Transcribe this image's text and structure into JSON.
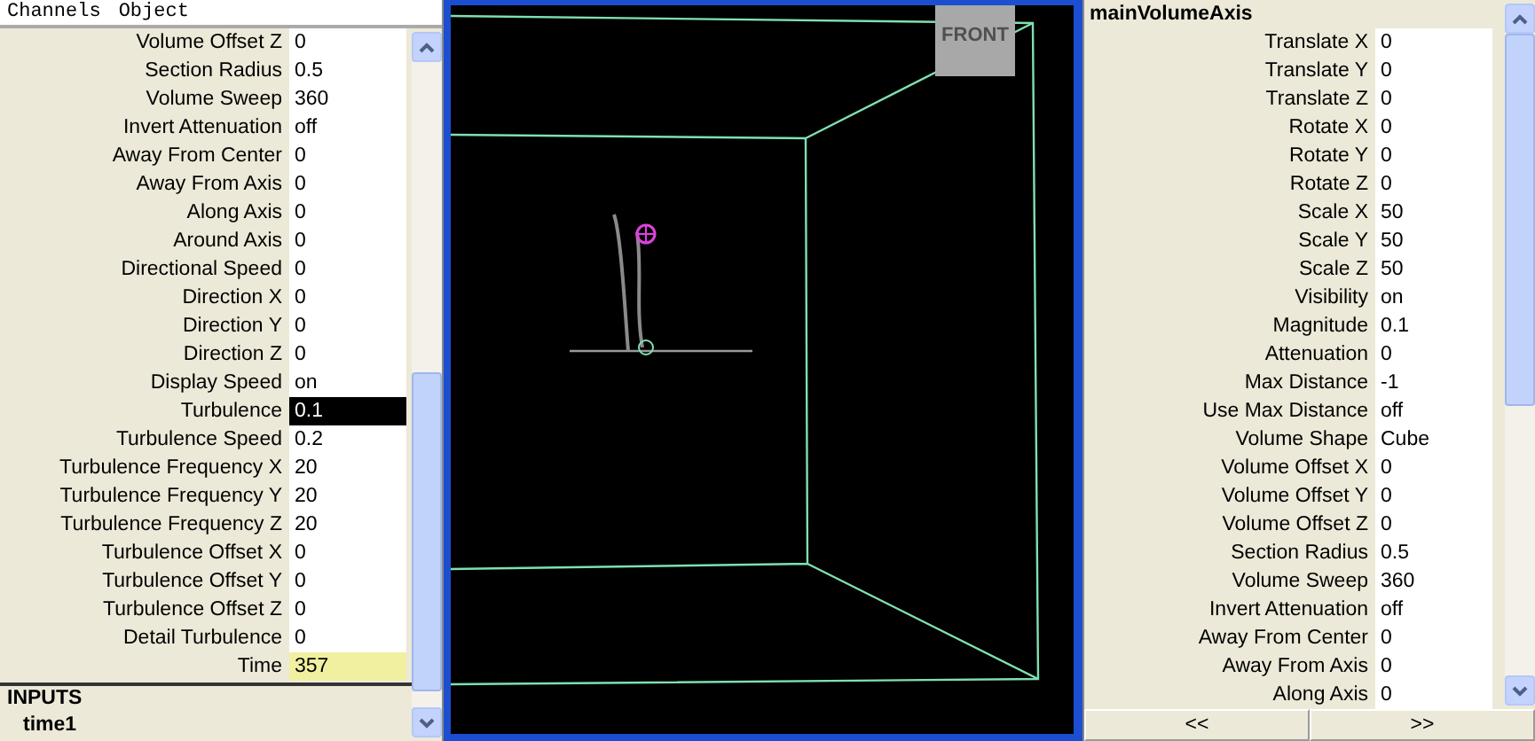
{
  "menu": [
    "Channels",
    "Object"
  ],
  "channels": [
    {
      "label": "Volume Offset Z",
      "value": "0",
      "selected": false,
      "keyed": false
    },
    {
      "label": "Section Radius",
      "value": "0.5",
      "selected": false,
      "keyed": false
    },
    {
      "label": "Volume Sweep",
      "value": "360",
      "selected": false,
      "keyed": false
    },
    {
      "label": "Invert Attenuation",
      "value": "off",
      "selected": false,
      "keyed": false
    },
    {
      "label": "Away From Center",
      "value": "0",
      "selected": false,
      "keyed": false
    },
    {
      "label": "Away From Axis",
      "value": "0",
      "selected": false,
      "keyed": false
    },
    {
      "label": "Along Axis",
      "value": "0",
      "selected": false,
      "keyed": false
    },
    {
      "label": "Around Axis",
      "value": "0",
      "selected": false,
      "keyed": false
    },
    {
      "label": "Directional Speed",
      "value": "0",
      "selected": false,
      "keyed": false
    },
    {
      "label": "Direction X",
      "value": "0",
      "selected": false,
      "keyed": false
    },
    {
      "label": "Direction Y",
      "value": "0",
      "selected": false,
      "keyed": false
    },
    {
      "label": "Direction Z",
      "value": "0",
      "selected": false,
      "keyed": false
    },
    {
      "label": "Display Speed",
      "value": "on",
      "selected": false,
      "keyed": false
    },
    {
      "label": "Turbulence",
      "value": "0.1",
      "selected": true,
      "keyed": false
    },
    {
      "label": "Turbulence Speed",
      "value": "0.2",
      "selected": false,
      "keyed": false
    },
    {
      "label": "Turbulence Frequency X",
      "value": "20",
      "selected": false,
      "keyed": false
    },
    {
      "label": "Turbulence Frequency Y",
      "value": "20",
      "selected": false,
      "keyed": false
    },
    {
      "label": "Turbulence Frequency Z",
      "value": "20",
      "selected": false,
      "keyed": false
    },
    {
      "label": "Turbulence Offset X",
      "value": "0",
      "selected": false,
      "keyed": false
    },
    {
      "label": "Turbulence Offset Y",
      "value": "0",
      "selected": false,
      "keyed": false
    },
    {
      "label": "Turbulence Offset Z",
      "value": "0",
      "selected": false,
      "keyed": false
    },
    {
      "label": "Detail Turbulence",
      "value": "0",
      "selected": false,
      "keyed": false
    },
    {
      "label": "Time",
      "value": "357",
      "selected": false,
      "keyed": true
    }
  ],
  "inputs": {
    "heading": "INPUTS",
    "items": [
      "time1"
    ]
  },
  "viewport": {
    "view_label": "FRONT"
  },
  "attributes": {
    "title": "mainVolumeAxis",
    "rows": [
      {
        "label": "Translate X",
        "value": "0"
      },
      {
        "label": "Translate Y",
        "value": "0"
      },
      {
        "label": "Translate Z",
        "value": "0"
      },
      {
        "label": "Rotate X",
        "value": "0"
      },
      {
        "label": "Rotate Y",
        "value": "0"
      },
      {
        "label": "Rotate Z",
        "value": "0"
      },
      {
        "label": "Scale X",
        "value": "50"
      },
      {
        "label": "Scale Y",
        "value": "50"
      },
      {
        "label": "Scale Z",
        "value": "50"
      },
      {
        "label": "Visibility",
        "value": "on"
      },
      {
        "label": "Magnitude",
        "value": "0.1"
      },
      {
        "label": "Attenuation",
        "value": "0"
      },
      {
        "label": "Max Distance",
        "value": "-1"
      },
      {
        "label": "Use Max Distance",
        "value": "off"
      },
      {
        "label": "Volume Shape",
        "value": "Cube"
      },
      {
        "label": "Volume Offset X",
        "value": "0"
      },
      {
        "label": "Volume Offset Y",
        "value": "0"
      },
      {
        "label": "Volume Offset Z",
        "value": "0"
      },
      {
        "label": "Section Radius",
        "value": "0.5"
      },
      {
        "label": "Volume Sweep",
        "value": "360"
      },
      {
        "label": "Invert Attenuation",
        "value": "off"
      },
      {
        "label": "Away From Center",
        "value": "0"
      },
      {
        "label": "Away From Axis",
        "value": "0"
      },
      {
        "label": "Along Axis",
        "value": "0"
      }
    ],
    "buttons": [
      "<<",
      ">>"
    ]
  }
}
